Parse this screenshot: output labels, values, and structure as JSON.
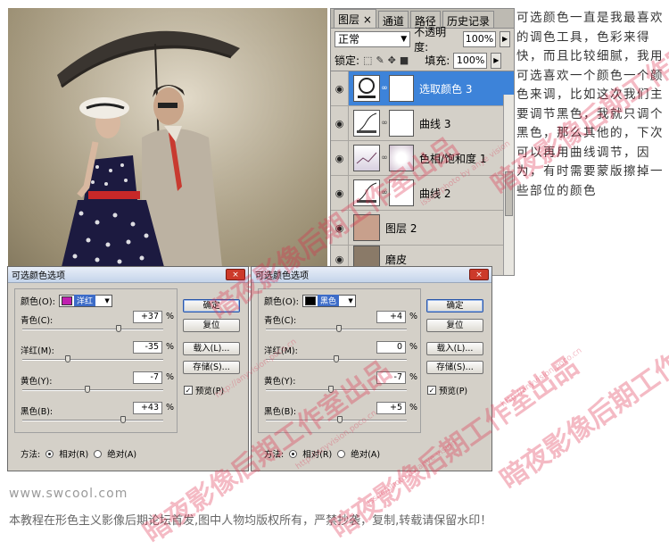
{
  "photo": {
    "alt": ""
  },
  "layers_panel": {
    "tabs": [
      {
        "label": "图层",
        "close": "×"
      },
      {
        "label": "通道"
      },
      {
        "label": "路径"
      },
      {
        "label": "历史记录"
      }
    ],
    "blend_mode": "正常",
    "opacity_label": "不透明度:",
    "opacity_value": "100%",
    "lock_label": "锁定:",
    "fill_label": "填充:",
    "fill_value": "100%",
    "layers": [
      {
        "name": "选取颜色 3",
        "selected": true,
        "type": "adjustment"
      },
      {
        "name": "曲线 3",
        "selected": false,
        "type": "curves"
      },
      {
        "name": "色相/饱和度 1",
        "selected": false,
        "type": "huesat"
      },
      {
        "name": "曲线 2",
        "selected": false,
        "type": "curves"
      },
      {
        "name": "图层 2",
        "selected": false,
        "type": "pixel"
      },
      {
        "name": "磨皮",
        "selected": false,
        "type": "pixel"
      }
    ]
  },
  "side_text": "可选颜色一直是我最喜欢的调色工具，色彩来得快，而且比较细腻，我用可选喜欢一个颜色一个颜色来调，比如这次我们主要调节黑色，我就只调个黑色，那么其他的，下次可以再用曲线调节，因为，有时需要蒙版擦掉一些部位的颜色",
  "dialog_left": {
    "title": "可选颜色选项",
    "close": "×",
    "color_label": "颜色(O):",
    "color_name": "洋红",
    "swatch_color": "#c020b0",
    "params": [
      {
        "label": "青色(C):",
        "value": "+37",
        "unit": "%",
        "level": 0.685
      },
      {
        "label": "洋红(M):",
        "value": "-35",
        "unit": "%",
        "level": 0.325
      },
      {
        "label": "黄色(Y):",
        "value": "-7",
        "unit": "%",
        "level": 0.465
      },
      {
        "label": "黑色(B):",
        "value": "+43",
        "unit": "%",
        "level": 0.715
      }
    ],
    "buttons": {
      "ok": "确定",
      "reset": "复位",
      "load": "载入(L)...",
      "save": "存储(S)..."
    },
    "preview_label": "预览(P)",
    "method_label": "方法:",
    "relative_label": "相对(R)",
    "absolute_label": "绝对(A)"
  },
  "dialog_right": {
    "title": "可选颜色选项",
    "close": "×",
    "color_label": "颜色(O):",
    "color_name": "黑色",
    "swatch_color": "#000000",
    "params": [
      {
        "label": "青色(C):",
        "value": "+4",
        "unit": "%",
        "level": 0.52
      },
      {
        "label": "洋红(M):",
        "value": "0",
        "unit": "%",
        "level": 0.5
      },
      {
        "label": "黄色(Y):",
        "value": "-7",
        "unit": "%",
        "level": 0.465
      },
      {
        "label": "黑色(B):",
        "value": "+5",
        "unit": "%",
        "level": 0.525
      }
    ],
    "buttons": {
      "ok": "确定",
      "reset": "复位",
      "load": "载入(L)...",
      "save": "存储(S)..."
    },
    "preview_label": "预览(P)",
    "method_label": "方法:",
    "relative_label": "相对(R)",
    "absolute_label": "绝对(A)"
  },
  "footer": {
    "url": "www.swcool.com",
    "note": "本教程在形色主义影像后期论坛首发,图中人物均版权所有，严禁抄袭，复制,转载请保留水印！"
  },
  "watermarks": {
    "studio": "暗夜影像后期工作室出品",
    "url": "http://anyvision.poco.cn",
    "credit": "issue/photo by anye vision"
  },
  "colors": {
    "selected_layer": "#3d83d9",
    "panel_bg": "#d4d0c8",
    "watermark": "#dc2846"
  }
}
